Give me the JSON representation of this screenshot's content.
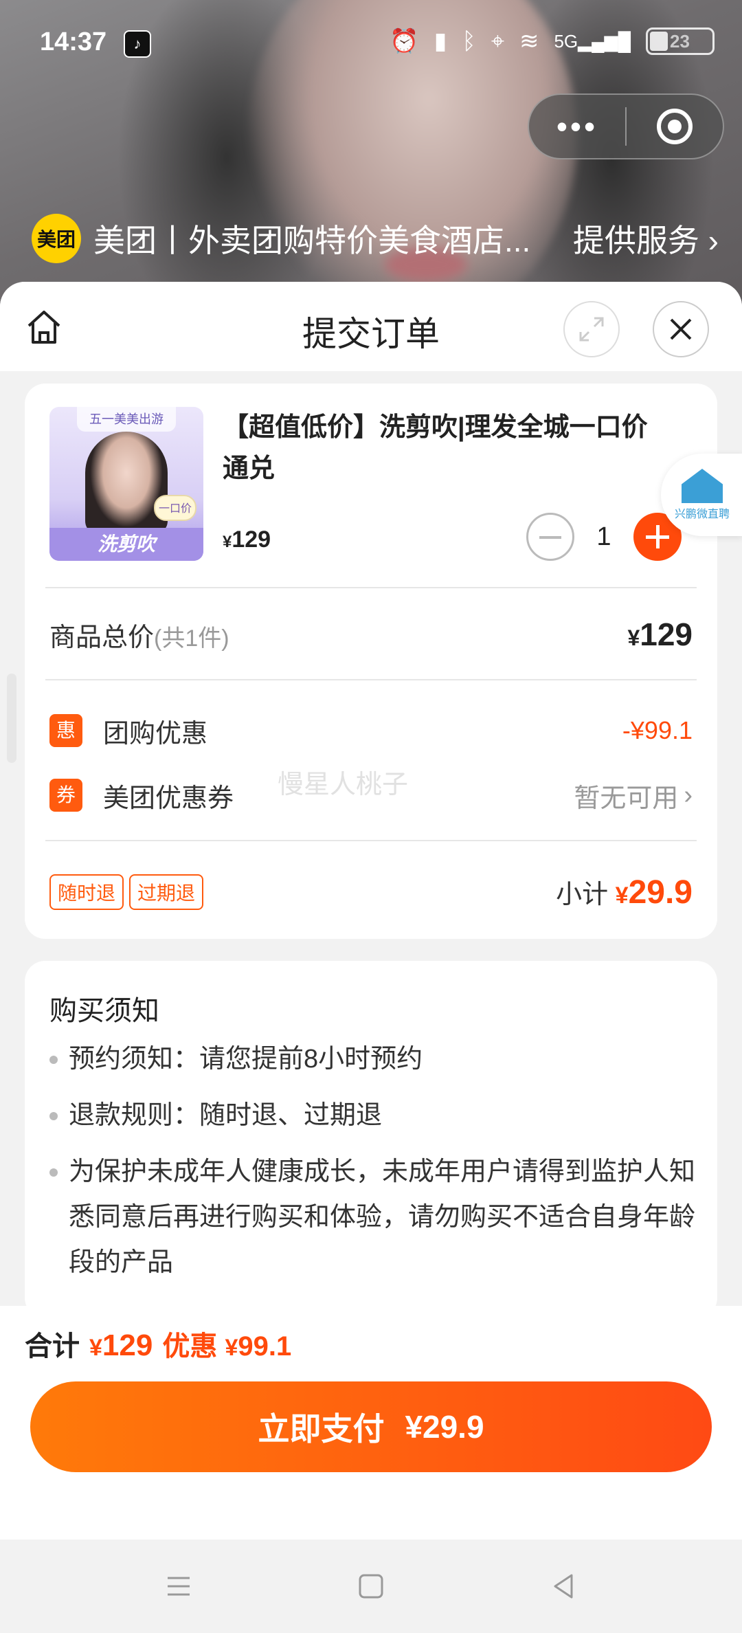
{
  "status_bar": {
    "time": "14:37",
    "battery": "23",
    "network": "5G"
  },
  "provider": {
    "logo": "美团",
    "name": "美团丨外卖团购特价美食酒店...",
    "service": "提供服务"
  },
  "sheet": {
    "title": "提交订单"
  },
  "product": {
    "thumb_tag": "五一美美出游",
    "thumb_badge": "一口价",
    "thumb_ribbon": "洗剪吹",
    "title": "【超值低价】洗剪吹|理发全城一口价通兑",
    "price_symbol": "¥",
    "price": "129",
    "quantity": "1"
  },
  "totals": {
    "label": "商品总价",
    "count": "(共1件)",
    "symbol": "¥",
    "value": "129",
    "group_discount_icon": "惠",
    "group_discount_label": "团购优惠",
    "group_discount_value": "-¥99.1",
    "coupon_icon": "券",
    "coupon_label": "美团优惠券",
    "coupon_value": "暂无可用",
    "tags": [
      "随时退",
      "过期退"
    ],
    "subtotal_label": "小计",
    "subtotal_symbol": "¥",
    "subtotal_value": "29.9"
  },
  "watermark": "慢星人桃子",
  "side_logo": "兴鹏微直聘",
  "notice": {
    "title": "购买须知",
    "items": [
      "预约须知：请您提前8小时预约",
      "退款规则：随时退、过期退",
      "为保护未成年人健康成长，未成年用户请得到监护人知悉同意后再进行购买和体验，请勿购买不适合自身年龄段的产品"
    ]
  },
  "bottom": {
    "sum_label": "合计",
    "sum_symbol": "¥",
    "sum_value": "129",
    "discount_label": "优惠",
    "discount_symbol": "¥",
    "discount_value": "99.1",
    "pay_label": "立即支付",
    "pay_amount": "¥29.9"
  },
  "colors": {
    "accent": "#ff4a0b",
    "meituan_yellow": "#ffd100"
  }
}
